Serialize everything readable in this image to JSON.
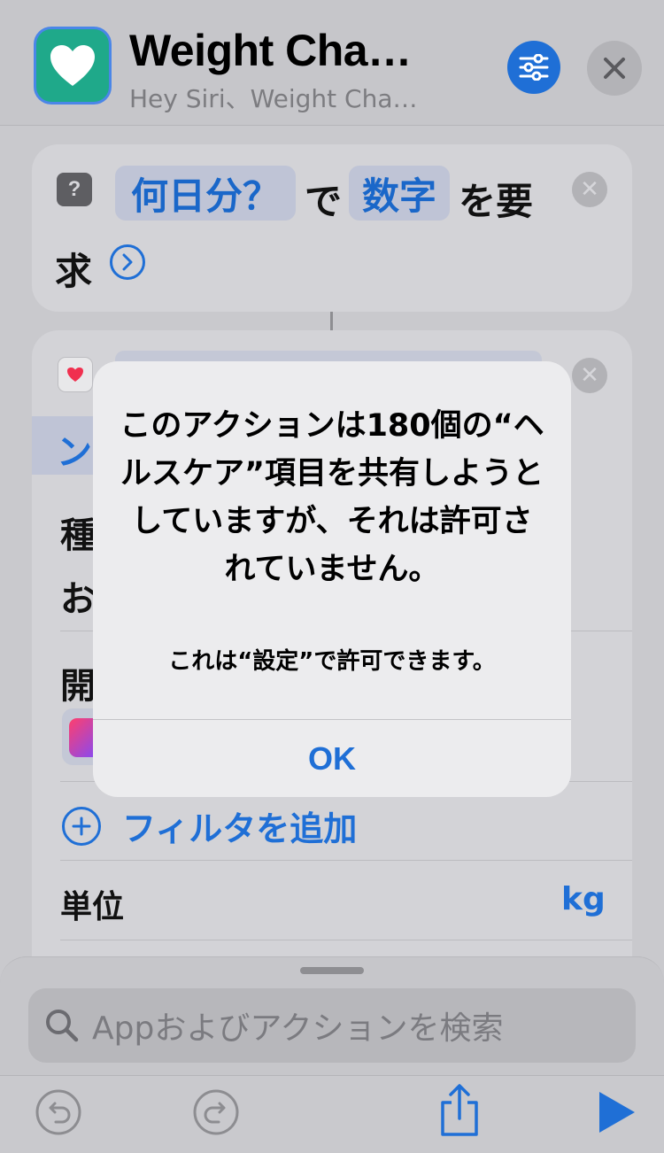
{
  "header": {
    "title": "Weight Cha…",
    "subtitle": "Hey Siri、Weight Cha…"
  },
  "action1": {
    "question_token": "何日分？",
    "connector_text": "で",
    "type_token": "数字",
    "line1_end": "を要",
    "line2": "求"
  },
  "action2": {
    "row_partial_1": "ン",
    "row_partial_2": "種",
    "row_partial_3": "お",
    "row_partial_4": "開",
    "add_filter_label": "フィルタを追加",
    "unit_label": "単位",
    "unit_value": "kg"
  },
  "alert": {
    "title": "このアクションは180個の“ヘルスケア”項目を共有しようとしていますが、それは許可されていません。",
    "message": "これは“設定”で許可できます。",
    "ok_label": "OK"
  },
  "search": {
    "placeholder": "Appおよびアクションを検索"
  },
  "colors": {
    "accent": "#1f6fd6",
    "app_icon": "#1fa98a"
  }
}
